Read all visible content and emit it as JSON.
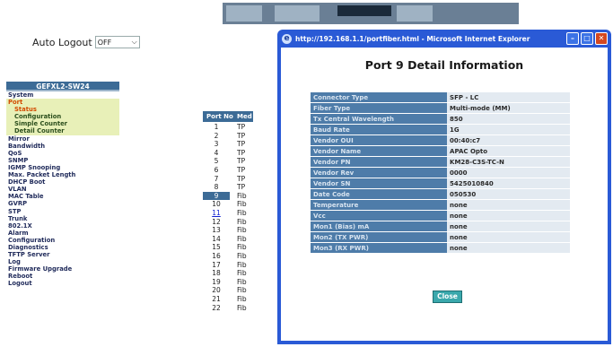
{
  "auto_logout": {
    "label": "Auto Logout",
    "value": "OFF"
  },
  "nav": {
    "header": "GEFXL2-SW24",
    "items": [
      {
        "label": "System",
        "kind": "top"
      },
      {
        "label": "Port",
        "kind": "port"
      },
      {
        "label": "Status",
        "kind": "sub-status"
      },
      {
        "label": "Configuration",
        "kind": "sub"
      },
      {
        "label": "Simple Counter",
        "kind": "sub"
      },
      {
        "label": "Detail Counter",
        "kind": "sub"
      },
      {
        "label": "Mirror",
        "kind": "top"
      },
      {
        "label": "Bandwidth",
        "kind": "top"
      },
      {
        "label": "QoS",
        "kind": "top"
      },
      {
        "label": "SNMP",
        "kind": "top"
      },
      {
        "label": "IGMP Snooping",
        "kind": "top"
      },
      {
        "label": "Max. Packet Length",
        "kind": "top"
      },
      {
        "label": "DHCP Boot",
        "kind": "top"
      },
      {
        "label": "VLAN",
        "kind": "top"
      },
      {
        "label": "MAC Table",
        "kind": "top"
      },
      {
        "label": "GVRP",
        "kind": "top"
      },
      {
        "label": "STP",
        "kind": "top"
      },
      {
        "label": "Trunk",
        "kind": "top"
      },
      {
        "label": "802.1X",
        "kind": "top"
      },
      {
        "label": "Alarm",
        "kind": "top"
      },
      {
        "label": "Configuration",
        "kind": "top"
      },
      {
        "label": "Diagnostics",
        "kind": "top"
      },
      {
        "label": "TFTP Server",
        "kind": "top"
      },
      {
        "label": "Log",
        "kind": "top"
      },
      {
        "label": "Firmware Upgrade",
        "kind": "top"
      },
      {
        "label": "Reboot",
        "kind": "top"
      },
      {
        "label": "Logout",
        "kind": "top"
      }
    ]
  },
  "port_table": {
    "col_port": "Port No",
    "col_media": "Med",
    "rows": [
      {
        "num": "1",
        "media": "TP"
      },
      {
        "num": "2",
        "media": "TP"
      },
      {
        "num": "3",
        "media": "TP"
      },
      {
        "num": "4",
        "media": "TP"
      },
      {
        "num": "5",
        "media": "TP"
      },
      {
        "num": "6",
        "media": "TP"
      },
      {
        "num": "7",
        "media": "TP"
      },
      {
        "num": "8",
        "media": "TP"
      },
      {
        "num": "9",
        "media": "Fib",
        "state": "selected"
      },
      {
        "num": "10",
        "media": "Fib"
      },
      {
        "num": "11",
        "media": "Fib",
        "state": "link"
      },
      {
        "num": "12",
        "media": "Fib"
      },
      {
        "num": "13",
        "media": "Fib"
      },
      {
        "num": "14",
        "media": "Fib"
      },
      {
        "num": "15",
        "media": "Fib"
      },
      {
        "num": "16",
        "media": "Fib"
      },
      {
        "num": "17",
        "media": "Fib"
      },
      {
        "num": "18",
        "media": "Fib"
      },
      {
        "num": "19",
        "media": "Fib"
      },
      {
        "num": "20",
        "media": "Fib"
      },
      {
        "num": "21",
        "media": "Fib"
      },
      {
        "num": "22",
        "media": "Fib"
      }
    ]
  },
  "popup": {
    "title": "http://192.168.1.1/portfiber.html - Microsoft Internet Explorer",
    "heading": "Port 9 Detail Information",
    "rows": [
      {
        "label": "Connector Type",
        "value": "SFP - LC"
      },
      {
        "label": "Fiber Type",
        "value": "Multi-mode (MM)"
      },
      {
        "label": "Tx Central Wavelength",
        "value": "850"
      },
      {
        "label": "Baud Rate",
        "value": "1G"
      },
      {
        "label": "Vendor OUI",
        "value": "00:40:c7"
      },
      {
        "label": "Vendor Name",
        "value": "APAC Opto"
      },
      {
        "label": "Vendor PN",
        "value": "KM28-C3S-TC-N"
      },
      {
        "label": "Vendor Rev",
        "value": "0000"
      },
      {
        "label": "Vendor SN",
        "value": "5425010840"
      },
      {
        "label": "Date Code",
        "value": "050530"
      },
      {
        "label": "Temperature",
        "value": "none"
      },
      {
        "label": "Vcc",
        "value": "none"
      },
      {
        "label": "Mon1 (Bias) mA",
        "value": "none"
      },
      {
        "label": "Mon2 (TX PWR)",
        "value": "none"
      },
      {
        "label": "Mon3 (RX PWR)",
        "value": "none"
      }
    ],
    "close_label": "Close"
  }
}
